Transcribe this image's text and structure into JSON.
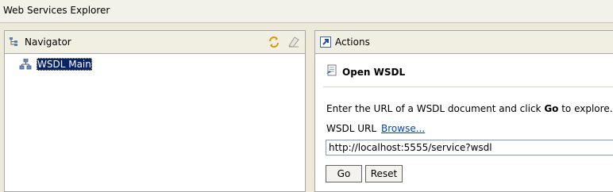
{
  "window": {
    "title": "Web Services Explorer"
  },
  "navigator": {
    "title": "Navigator",
    "tree": [
      {
        "label": "WSDL Main",
        "selected": true
      }
    ],
    "toolbar_icons": [
      "refresh-icon",
      "clear-icon"
    ]
  },
  "actions": {
    "title": "Actions",
    "section_title": "Open WSDL",
    "instruction_prefix": "Enter the URL of a WSDL document and click ",
    "instruction_bold": "Go",
    "instruction_suffix": " to explore.",
    "url_label": "WSDL URL",
    "browse_label": "Browse...",
    "url_value": "http://localhost:5555/service?wsdl",
    "go_label": "Go",
    "reset_label": "Reset"
  },
  "colors": {
    "selection": "#0a246a",
    "link": "#0044cc",
    "header_bg": "#f1efe2"
  }
}
